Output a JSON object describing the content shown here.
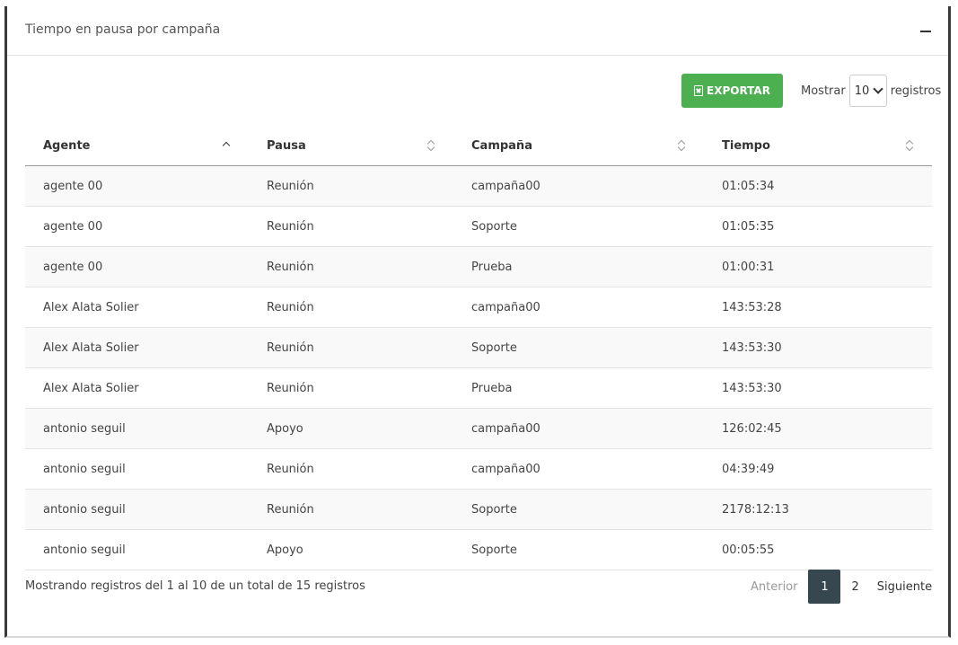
{
  "card": {
    "title": "Tiempo en pausa por campaña"
  },
  "toolbar": {
    "export_label": "EXPORTAR",
    "show_label": "Mostrar",
    "page_size": "10",
    "records_label": "registros"
  },
  "table": {
    "headers": [
      "Agente",
      "Pausa",
      "Campaña",
      "Tiempo"
    ],
    "rows": [
      [
        "agente 00",
        "Reunión",
        "campaña00",
        "01:05:34"
      ],
      [
        "agente 00",
        "Reunión",
        "Soporte",
        "01:05:35"
      ],
      [
        "agente 00",
        "Reunión",
        "Prueba",
        "01:00:31"
      ],
      [
        "Alex Alata Solier",
        "Reunión",
        "campaña00",
        "143:53:28"
      ],
      [
        "Alex Alata Solier",
        "Reunión",
        "Soporte",
        "143:53:30"
      ],
      [
        "Alex Alata Solier",
        "Reunión",
        "Prueba",
        "143:53:30"
      ],
      [
        "antonio seguil",
        "Apoyo",
        "campaña00",
        "126:02:45"
      ],
      [
        "antonio seguil",
        "Reunión",
        "campaña00",
        "04:39:49"
      ],
      [
        "antonio seguil",
        "Reunión",
        "Soporte",
        "2178:12:13"
      ],
      [
        "antonio seguil",
        "Apoyo",
        "Soporte",
        "00:05:55"
      ]
    ]
  },
  "footer": {
    "info": "Mostrando registros del 1 al 10 de un total de 15 registros",
    "prev_label": "Anterior",
    "pages": [
      "1",
      "2"
    ],
    "next_label": "Siguiente"
  },
  "colors": {
    "export_button": "#4caf50",
    "active_page": "#37474f"
  }
}
